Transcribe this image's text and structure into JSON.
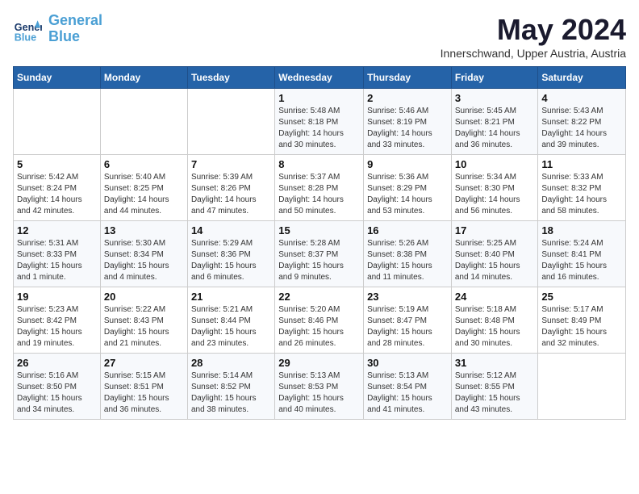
{
  "header": {
    "logo_line1": "General",
    "logo_line2": "Blue",
    "month": "May 2024",
    "location": "Innerschwand, Upper Austria, Austria"
  },
  "weekdays": [
    "Sunday",
    "Monday",
    "Tuesday",
    "Wednesday",
    "Thursday",
    "Friday",
    "Saturday"
  ],
  "weeks": [
    [
      {
        "day": "",
        "info": ""
      },
      {
        "day": "",
        "info": ""
      },
      {
        "day": "",
        "info": ""
      },
      {
        "day": "1",
        "info": "Sunrise: 5:48 AM\nSunset: 8:18 PM\nDaylight: 14 hours\nand 30 minutes."
      },
      {
        "day": "2",
        "info": "Sunrise: 5:46 AM\nSunset: 8:19 PM\nDaylight: 14 hours\nand 33 minutes."
      },
      {
        "day": "3",
        "info": "Sunrise: 5:45 AM\nSunset: 8:21 PM\nDaylight: 14 hours\nand 36 minutes."
      },
      {
        "day": "4",
        "info": "Sunrise: 5:43 AM\nSunset: 8:22 PM\nDaylight: 14 hours\nand 39 minutes."
      }
    ],
    [
      {
        "day": "5",
        "info": "Sunrise: 5:42 AM\nSunset: 8:24 PM\nDaylight: 14 hours\nand 42 minutes."
      },
      {
        "day": "6",
        "info": "Sunrise: 5:40 AM\nSunset: 8:25 PM\nDaylight: 14 hours\nand 44 minutes."
      },
      {
        "day": "7",
        "info": "Sunrise: 5:39 AM\nSunset: 8:26 PM\nDaylight: 14 hours\nand 47 minutes."
      },
      {
        "day": "8",
        "info": "Sunrise: 5:37 AM\nSunset: 8:28 PM\nDaylight: 14 hours\nand 50 minutes."
      },
      {
        "day": "9",
        "info": "Sunrise: 5:36 AM\nSunset: 8:29 PM\nDaylight: 14 hours\nand 53 minutes."
      },
      {
        "day": "10",
        "info": "Sunrise: 5:34 AM\nSunset: 8:30 PM\nDaylight: 14 hours\nand 56 minutes."
      },
      {
        "day": "11",
        "info": "Sunrise: 5:33 AM\nSunset: 8:32 PM\nDaylight: 14 hours\nand 58 minutes."
      }
    ],
    [
      {
        "day": "12",
        "info": "Sunrise: 5:31 AM\nSunset: 8:33 PM\nDaylight: 15 hours\nand 1 minute."
      },
      {
        "day": "13",
        "info": "Sunrise: 5:30 AM\nSunset: 8:34 PM\nDaylight: 15 hours\nand 4 minutes."
      },
      {
        "day": "14",
        "info": "Sunrise: 5:29 AM\nSunset: 8:36 PM\nDaylight: 15 hours\nand 6 minutes."
      },
      {
        "day": "15",
        "info": "Sunrise: 5:28 AM\nSunset: 8:37 PM\nDaylight: 15 hours\nand 9 minutes."
      },
      {
        "day": "16",
        "info": "Sunrise: 5:26 AM\nSunset: 8:38 PM\nDaylight: 15 hours\nand 11 minutes."
      },
      {
        "day": "17",
        "info": "Sunrise: 5:25 AM\nSunset: 8:40 PM\nDaylight: 15 hours\nand 14 minutes."
      },
      {
        "day": "18",
        "info": "Sunrise: 5:24 AM\nSunset: 8:41 PM\nDaylight: 15 hours\nand 16 minutes."
      }
    ],
    [
      {
        "day": "19",
        "info": "Sunrise: 5:23 AM\nSunset: 8:42 PM\nDaylight: 15 hours\nand 19 minutes."
      },
      {
        "day": "20",
        "info": "Sunrise: 5:22 AM\nSunset: 8:43 PM\nDaylight: 15 hours\nand 21 minutes."
      },
      {
        "day": "21",
        "info": "Sunrise: 5:21 AM\nSunset: 8:44 PM\nDaylight: 15 hours\nand 23 minutes."
      },
      {
        "day": "22",
        "info": "Sunrise: 5:20 AM\nSunset: 8:46 PM\nDaylight: 15 hours\nand 26 minutes."
      },
      {
        "day": "23",
        "info": "Sunrise: 5:19 AM\nSunset: 8:47 PM\nDaylight: 15 hours\nand 28 minutes."
      },
      {
        "day": "24",
        "info": "Sunrise: 5:18 AM\nSunset: 8:48 PM\nDaylight: 15 hours\nand 30 minutes."
      },
      {
        "day": "25",
        "info": "Sunrise: 5:17 AM\nSunset: 8:49 PM\nDaylight: 15 hours\nand 32 minutes."
      }
    ],
    [
      {
        "day": "26",
        "info": "Sunrise: 5:16 AM\nSunset: 8:50 PM\nDaylight: 15 hours\nand 34 minutes."
      },
      {
        "day": "27",
        "info": "Sunrise: 5:15 AM\nSunset: 8:51 PM\nDaylight: 15 hours\nand 36 minutes."
      },
      {
        "day": "28",
        "info": "Sunrise: 5:14 AM\nSunset: 8:52 PM\nDaylight: 15 hours\nand 38 minutes."
      },
      {
        "day": "29",
        "info": "Sunrise: 5:13 AM\nSunset: 8:53 PM\nDaylight: 15 hours\nand 40 minutes."
      },
      {
        "day": "30",
        "info": "Sunrise: 5:13 AM\nSunset: 8:54 PM\nDaylight: 15 hours\nand 41 minutes."
      },
      {
        "day": "31",
        "info": "Sunrise: 5:12 AM\nSunset: 8:55 PM\nDaylight: 15 hours\nand 43 minutes."
      },
      {
        "day": "",
        "info": ""
      }
    ]
  ]
}
